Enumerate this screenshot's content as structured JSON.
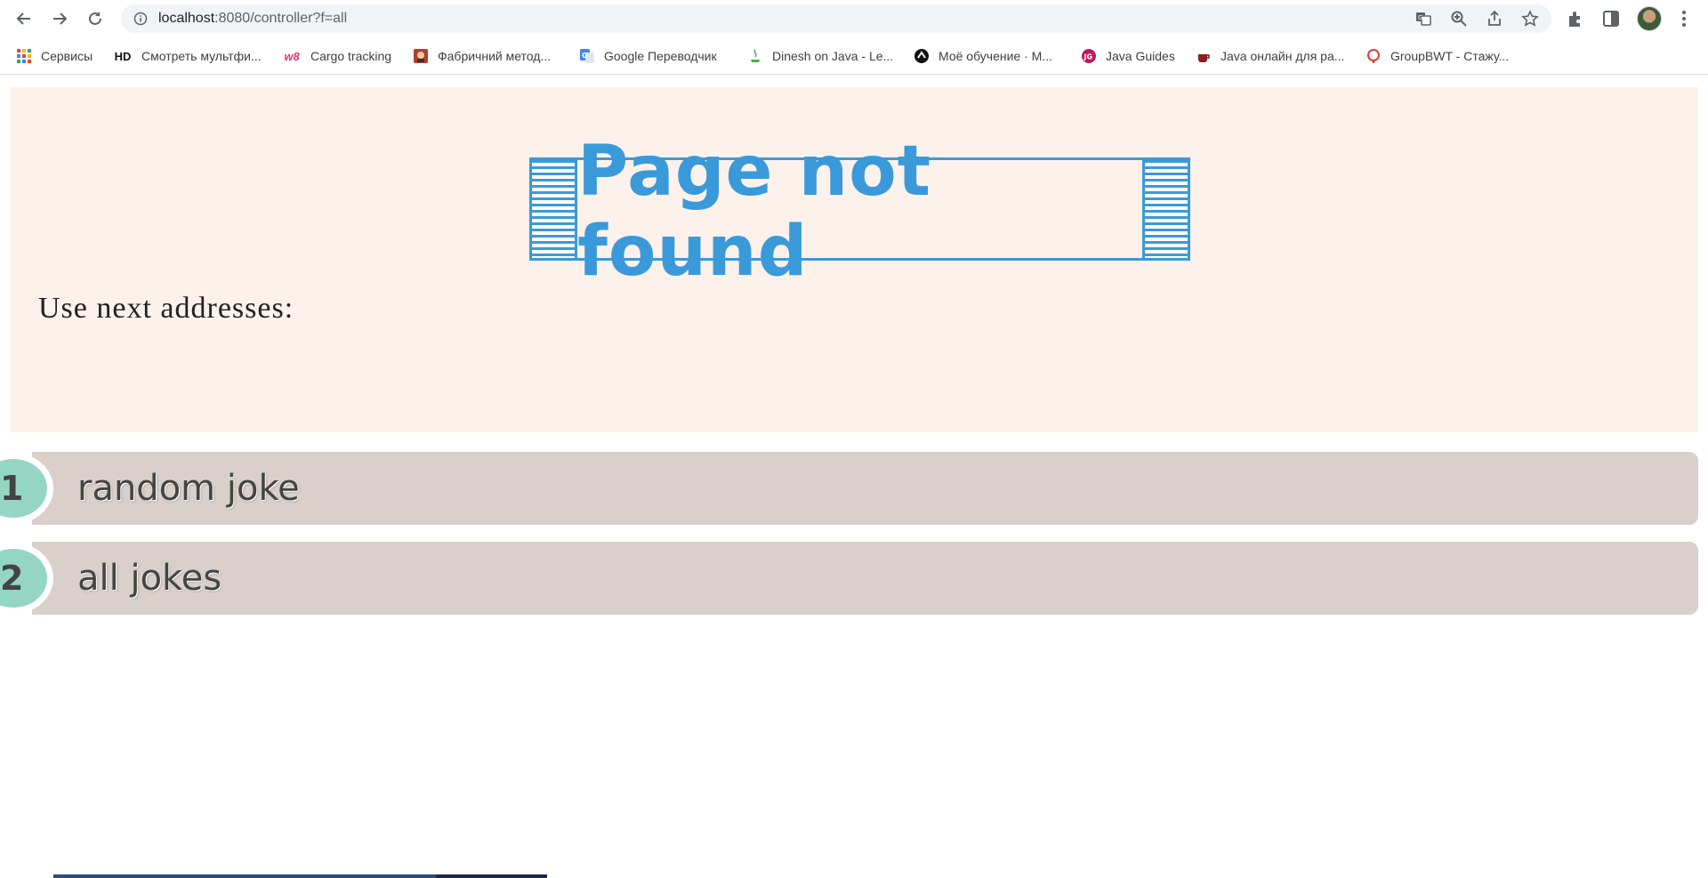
{
  "browser": {
    "url_host": "localhost",
    "url_rest": ":8080/controller?f=all",
    "bookmarks": [
      {
        "label": "Сервисы",
        "icon": "apps-grid-icon"
      },
      {
        "label": "Смотреть мультфи...",
        "icon": "hd-icon",
        "icon_text": "HD"
      },
      {
        "label": "Cargo tracking",
        "icon": "w8-icon",
        "icon_text": "w8"
      },
      {
        "label": "Фабричний метод...",
        "icon": "refactoring-guru-icon"
      },
      {
        "label": "Google Переводчик",
        "icon": "google-translate-icon"
      },
      {
        "label": "Dinesh on Java - Le...",
        "icon": "java-cup-icon"
      },
      {
        "label": "Моё обучение · M...",
        "icon": "learning-icon"
      },
      {
        "label": "Java Guides",
        "icon": "java-guides-icon"
      },
      {
        "label": "Java онлайн для ра...",
        "icon": "javarush-icon"
      },
      {
        "label": "GroupBWT - Стажу...",
        "icon": "groupbwt-icon"
      }
    ]
  },
  "page": {
    "title": "Page not found",
    "subtitle": "Use next addresses:",
    "links": [
      {
        "number": "1",
        "label": "random joke"
      },
      {
        "number": "2",
        "label": "all jokes"
      }
    ]
  },
  "colors": {
    "accent": "#3a9ad9",
    "hero_bg": "#fdf1ec",
    "row_bg": "#d9d0cb",
    "badge": "#94d6c1"
  }
}
